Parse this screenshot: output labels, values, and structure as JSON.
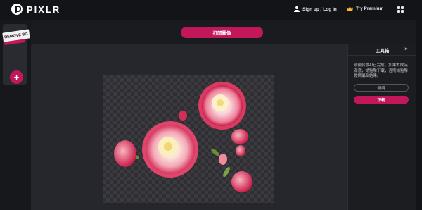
{
  "header": {
    "logo_text": "PIXLR",
    "signup_label": "Sign up / Log in",
    "premium_label": "Try Premium",
    "icons": [
      "pixlr-logo-icon",
      "user-icon",
      "crown-icon",
      "apps-grid-icon"
    ]
  },
  "sidebar": {
    "tool_label": "REMOVE BG",
    "add_label": "+"
  },
  "toolbar": {
    "open_image_label": "打開圖像"
  },
  "panel": {
    "title": "工具箱",
    "close_label": "×",
    "description": "剛剛背景AI已完成，如果對成品滿意，請點擊下載，否則請點擊微調編輯結果。",
    "reset_label": "微調",
    "download_label": "下載"
  },
  "colors": {
    "accent": "#c2185b",
    "background": "#1a1b1f",
    "panel": "#1c1d21",
    "workspace": "#26272c",
    "crown": "#f5b82e"
  }
}
